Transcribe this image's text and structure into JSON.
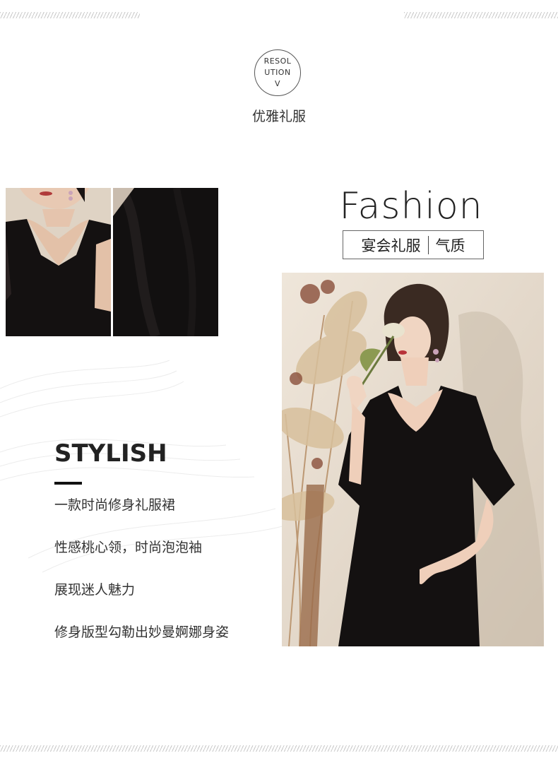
{
  "badge": {
    "line1": "RESOL",
    "line2": "UTION",
    "line3": "V"
  },
  "header_subtitle": "优雅礼服",
  "fashion": {
    "title": "Fashion",
    "tag_left": "宴会礼服",
    "tag_right": "气质"
  },
  "stylish": {
    "title": "STYLISH",
    "lines": [
      "一款时尚修身礼服裙",
      "性感桃心领，时尚泡泡袖",
      "展现迷人魅力",
      "修身版型勾勒出妙曼婀娜身姿"
    ]
  },
  "colors": {
    "dress": "#141111",
    "accent_bar": "#111111",
    "background": "#ffffff"
  }
}
